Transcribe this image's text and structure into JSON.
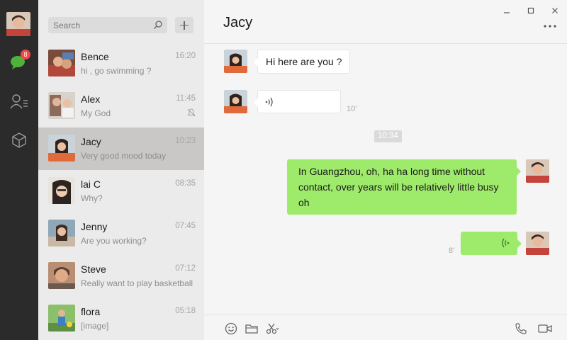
{
  "window": {
    "controls": [
      "minimize",
      "maximize",
      "close"
    ]
  },
  "rail": {
    "profile_avatar": "avatar-photo",
    "chats_badge": "8",
    "icons": [
      "chat-bubble-icon",
      "contacts-icon",
      "cube-icon"
    ],
    "accent_color": "#4fb33b"
  },
  "search": {
    "placeholder": "Search",
    "value": ""
  },
  "conversations": [
    {
      "name": "Bence",
      "time": "16:20",
      "preview": "hi , go swimming ?",
      "active": false,
      "muted": false
    },
    {
      "name": "Alex",
      "time": "11:45",
      "preview": "My God",
      "active": false,
      "muted": true
    },
    {
      "name": "Jacy",
      "time": "10:23",
      "preview": "Very good mood today",
      "active": true,
      "muted": false
    },
    {
      "name": "lai C",
      "time": "08:35",
      "preview": "Why?",
      "active": false,
      "muted": false
    },
    {
      "name": "Jenny",
      "time": "07:45",
      "preview": "Are you working?",
      "active": false,
      "muted": false
    },
    {
      "name": "Steve",
      "time": "07:12",
      "preview": "Really want to play basketball",
      "active": false,
      "muted": false
    },
    {
      "name": "flora",
      "time": "05:18",
      "preview": "[image]",
      "active": false,
      "muted": false
    }
  ],
  "chat": {
    "title": "Jacy",
    "messages": [
      {
        "side": "in",
        "type": "text",
        "text": "Hi here are you ?"
      },
      {
        "side": "in",
        "type": "voice",
        "duration": "10'"
      },
      {
        "type": "timestamp",
        "text": "10:34"
      },
      {
        "side": "out",
        "type": "text",
        "text": "In Guangzhou, oh, ha ha long time without contact, over years will be relatively little busy oh"
      },
      {
        "side": "out",
        "type": "voice",
        "duration": "8'"
      }
    ],
    "toolbar": [
      "emoji-icon",
      "folder-icon",
      "scissors-icon",
      "phone-icon",
      "video-icon"
    ],
    "outgoing_bubble_color": "#9eea6a",
    "incoming_bubble_color": "#ffffff"
  }
}
